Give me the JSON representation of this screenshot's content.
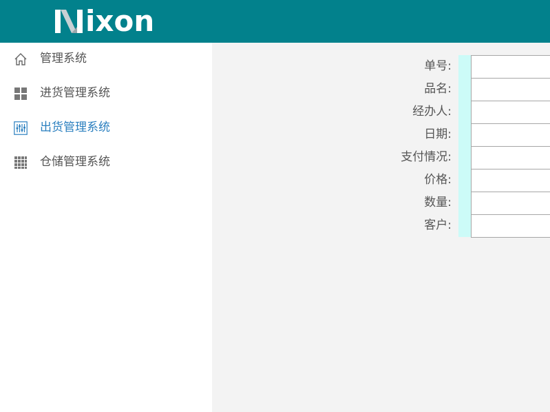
{
  "app": {
    "logo_text": "ixon",
    "brand_color": "#02818c"
  },
  "sidebar": {
    "items": [
      {
        "label": "管理系统",
        "icon": "home-icon",
        "active": false
      },
      {
        "label": "进货管理系统",
        "icon": "grid-four-icon",
        "active": false
      },
      {
        "label": "出货管理系统",
        "icon": "sliders-icon",
        "active": true
      },
      {
        "label": "仓储管理系统",
        "icon": "grid-nine-icon",
        "active": false
      }
    ],
    "active_color": "#2a7fbf"
  },
  "form": {
    "fields": [
      {
        "label": "单号:",
        "value": ""
      },
      {
        "label": "品名:",
        "value": ""
      },
      {
        "label": "经办人:",
        "value": ""
      },
      {
        "label": "日期:",
        "value": ""
      },
      {
        "label": "支付情况:",
        "value": ""
      },
      {
        "label": "价格:",
        "value": ""
      },
      {
        "label": "数量:",
        "value": ""
      },
      {
        "label": "客户:",
        "value": ""
      }
    ],
    "accent_color": "#ccfbf8"
  }
}
